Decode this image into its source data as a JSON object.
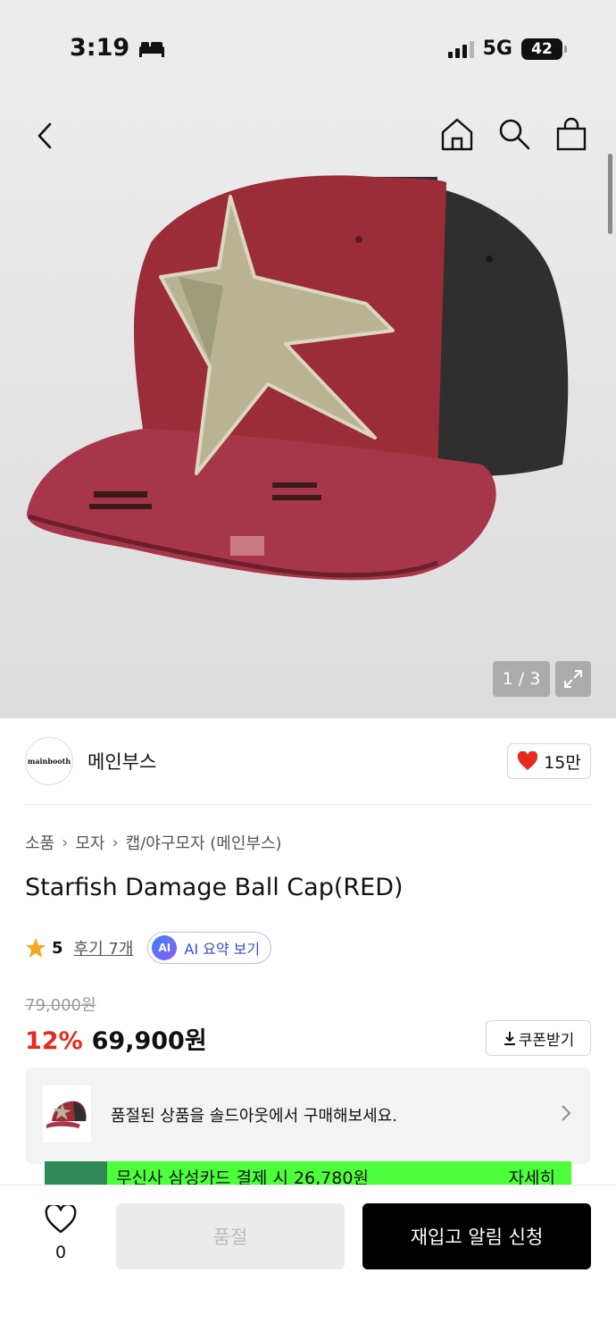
{
  "status_bar": {
    "time": "3:19",
    "network": "5G",
    "battery": "42"
  },
  "gallery": {
    "counter": "1 / 3"
  },
  "brand": {
    "logo_text": "mainbooth",
    "name": "메인부스",
    "like_count": "15만"
  },
  "breadcrumb": [
    "소품",
    "모자",
    "캡/야구모자 (메인부스)"
  ],
  "product": {
    "title": "Starfish Damage Ball Cap(RED)"
  },
  "rating": {
    "score": "5",
    "review_link": "후기 7개",
    "ai_badge": "AI",
    "ai_label": "AI 요약 보기"
  },
  "price": {
    "original": "79,000원",
    "discount": "12%",
    "sale": "69,900원",
    "coupon_label": "쿠폰받기"
  },
  "soldout_notice": {
    "text": "품절된 상품을 솔드아웃에서 구매해보세요."
  },
  "card_banner": {
    "text": "무신사 삼성카드 결제 시 26,780원",
    "detail": "자세히"
  },
  "bottom_bar": {
    "wish_count": "0",
    "soldout_label": "품절",
    "restock_label": "재입고 알림 신청"
  },
  "colors": {
    "accent_red": "#e8291d",
    "like_red": "#e8291d",
    "banner_green": "#4dff3a",
    "primary_black": "#000000"
  }
}
